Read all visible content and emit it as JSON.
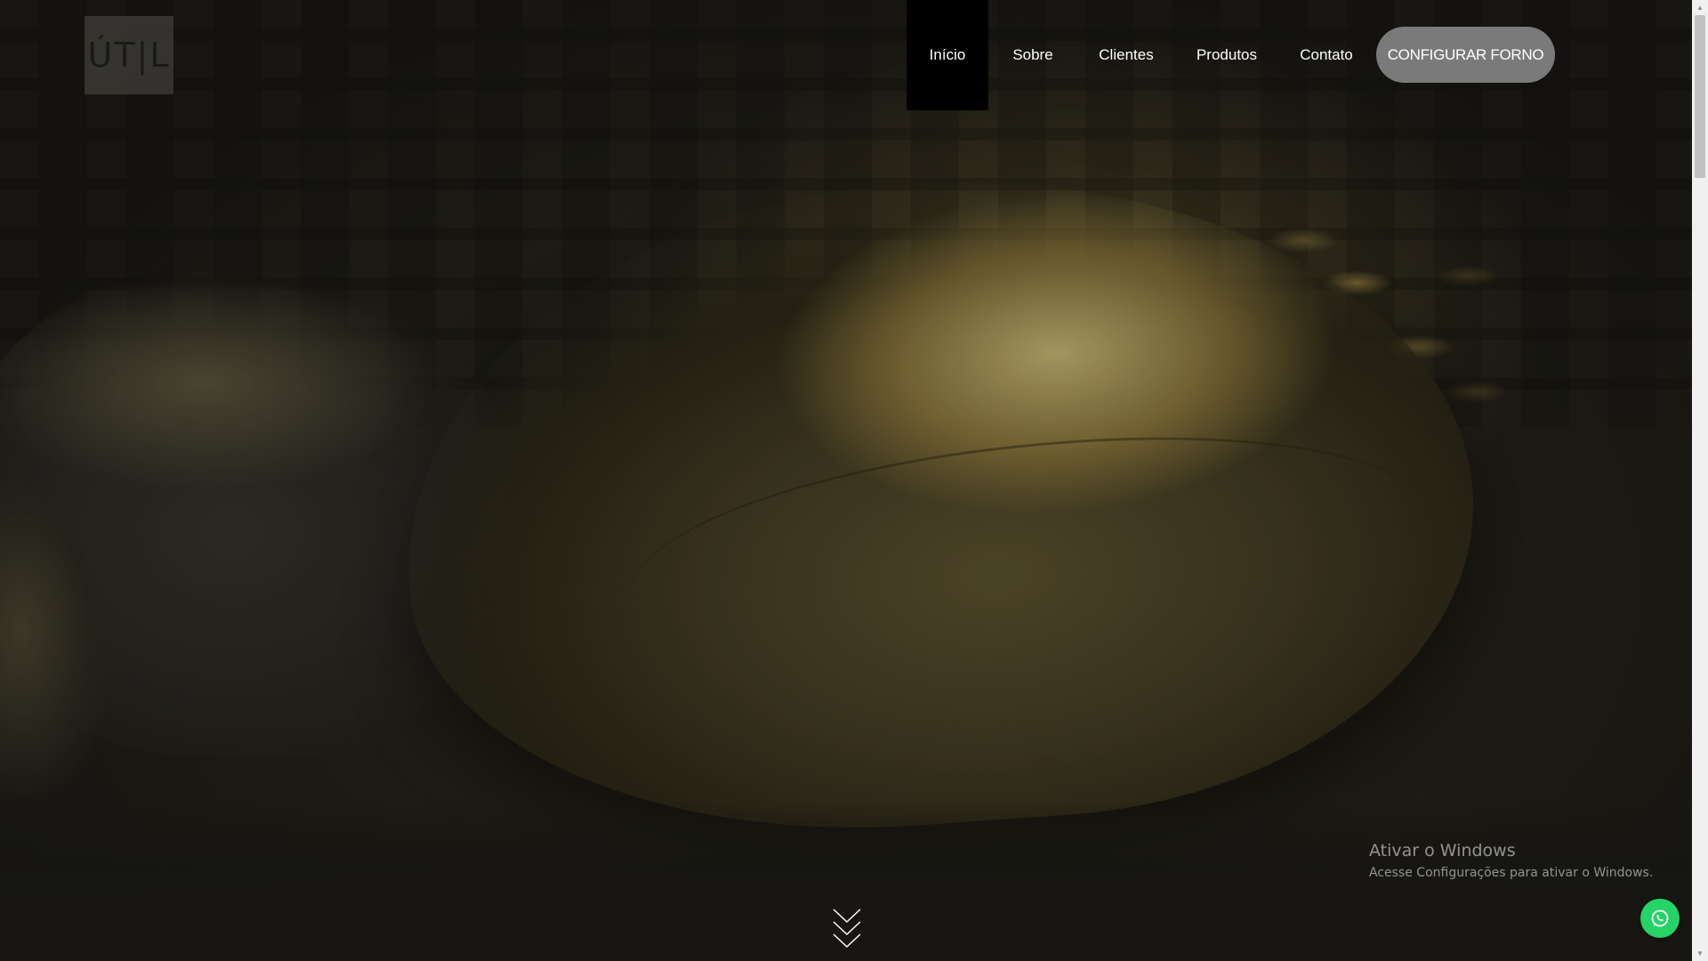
{
  "logo": {
    "text": "ÚT|L"
  },
  "nav": {
    "items": [
      {
        "label": "Início",
        "active": true
      },
      {
        "label": "Sobre"
      },
      {
        "label": "Clientes"
      },
      {
        "label": "Produtos"
      },
      {
        "label": "Contato"
      }
    ],
    "cta_label": "CONFIGURAR FORNO"
  },
  "hero": {
    "scroll_icon": "double-chevron-down-icon"
  },
  "windows_watermark": {
    "title": "Ativar o Windows",
    "subtitle": "Acesse Configurações para ativar o Windows."
  },
  "whatsapp": {
    "icon": "whatsapp-icon",
    "color": "#25d366"
  },
  "colors": {
    "active_nav_bg": "#000000",
    "cta_bg": "#7a7a7a"
  }
}
